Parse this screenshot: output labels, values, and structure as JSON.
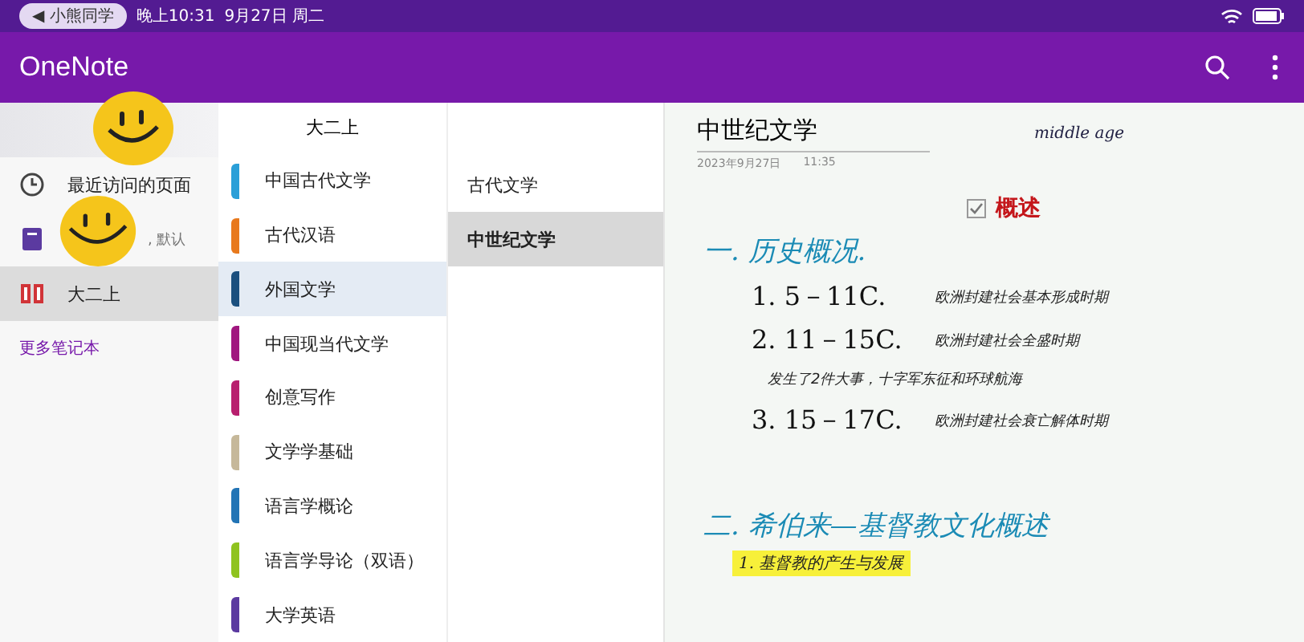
{
  "status_bar": {
    "back_chip": "◀ 小熊同学",
    "time": "晚上10:31",
    "date": "9月27日 周二"
  },
  "app_bar": {
    "title": "OneNote"
  },
  "nav": {
    "items": [
      {
        "kind": "recent",
        "label": "最近访问的页面",
        "selected": false
      },
      {
        "kind": "notebook",
        "label": ", 默认",
        "selected": false,
        "color": "#5b3aa0"
      },
      {
        "kind": "notebook-open",
        "label": "大二上",
        "selected": true,
        "color": "#d13438"
      }
    ],
    "more_link": "更多笔记本"
  },
  "sections": {
    "header": "大二上",
    "items": [
      {
        "label": "中国古代文学",
        "color": "#2a9fd8",
        "selected": false
      },
      {
        "label": "古代汉语",
        "color": "#e8791d",
        "selected": false
      },
      {
        "label": "外国文学",
        "color": "#1b4f7e",
        "selected": true
      },
      {
        "label": "中国现当代文学",
        "color": "#a0177f",
        "selected": false
      },
      {
        "label": "创意写作",
        "color": "#b81f6e",
        "selected": false
      },
      {
        "label": "文学学基础",
        "color": "#c6b89a",
        "selected": false
      },
      {
        "label": "语言学概论",
        "color": "#2274b5",
        "selected": false
      },
      {
        "label": "语言学导论（双语）",
        "color": "#8fc31f",
        "selected": false
      },
      {
        "label": "大学英语",
        "color": "#5b3aa0",
        "selected": false
      }
    ]
  },
  "pages": [
    {
      "label": "古代文学",
      "selected": false
    },
    {
      "label": "中世纪文学",
      "selected": true
    }
  ],
  "note": {
    "title": "中世纪文学",
    "date": "2023年9月27日",
    "time": "11:35",
    "aside": "middle age",
    "todo": {
      "label": "概述",
      "checked": true
    },
    "lines": [
      {
        "kind": "heading",
        "text": "一. 历史概况."
      },
      {
        "kind": "item",
        "text": "1. 5－11C.",
        "comment": "欧洲封建社会基本形成时期"
      },
      {
        "kind": "item",
        "text": "2. 11－15C.",
        "comment": "欧洲封建社会全盛时期"
      },
      {
        "kind": "remark",
        "text": "发生了2件大事，十字军东征和环球航海"
      },
      {
        "kind": "item",
        "text": "3. 15－17C.",
        "comment": "欧洲封建社会衰亡解体时期"
      },
      {
        "kind": "heading",
        "text": "二. 希伯来—基督教文化概述"
      },
      {
        "kind": "highlight",
        "text": "1. 基督教的产生与发展"
      }
    ]
  }
}
